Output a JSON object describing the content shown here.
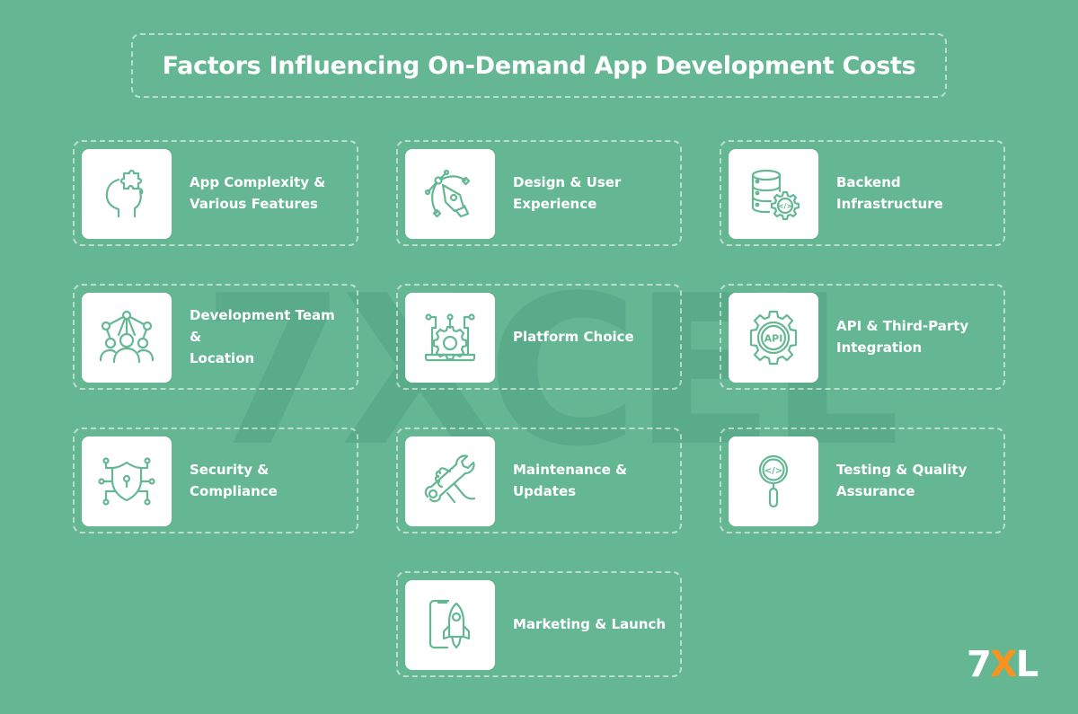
{
  "title": "Factors Influencing On-Demand App Development Costs",
  "watermark": "7XCEL",
  "colors": {
    "background": "#65b794",
    "icon_stroke": "#65b794",
    "card_icon_bg": "#ffffff",
    "logo_accent": "#f7931e"
  },
  "factors": [
    {
      "label": "App Complexity &\nVarious Features",
      "icon": "head-puzzle-icon"
    },
    {
      "label": "Design & User\nExperience",
      "icon": "pen-tool-icon"
    },
    {
      "label": "Backend\nInfrastructure",
      "icon": "database-gear-icon"
    },
    {
      "label": "Development Team &\nLocation",
      "icon": "team-network-icon"
    },
    {
      "label": "Platform Choice",
      "icon": "laptop-gear-icon"
    },
    {
      "label": "API & Third-Party\nIntegration",
      "icon": "api-gear-icon"
    },
    {
      "label": "Security &\nCompliance",
      "icon": "shield-circuit-icon"
    },
    {
      "label": "Maintenance &\nUpdates",
      "icon": "hand-wrench-icon"
    },
    {
      "label": "Testing & Quality\nAssurance",
      "icon": "code-magnifier-icon"
    },
    {
      "label": "Marketing & Launch",
      "icon": "phone-rocket-icon"
    }
  ],
  "icon_texts": {
    "api": "API",
    "code": "</>"
  },
  "logo": {
    "part1": "7",
    "part2": "X",
    "part3": "L"
  }
}
